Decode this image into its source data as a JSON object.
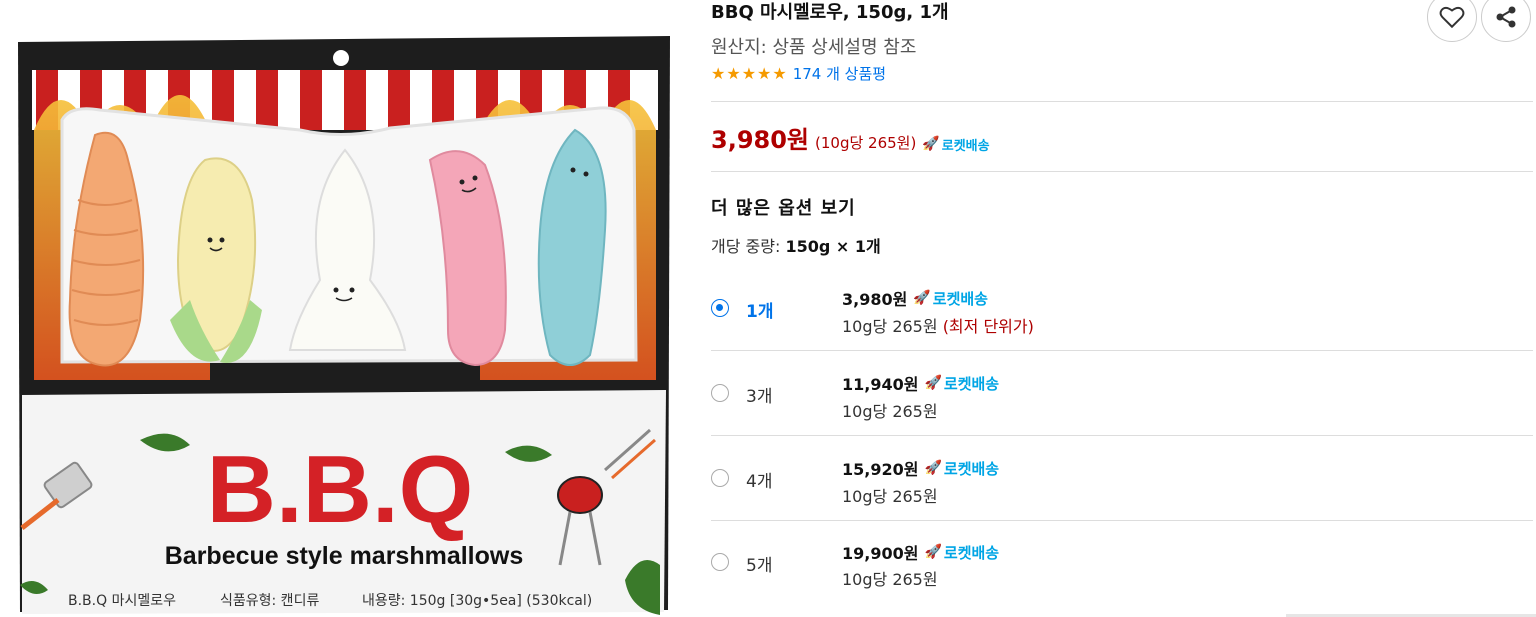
{
  "product": {
    "title": "BBQ 마시멜로우, 150g, 1개",
    "origin": "원산지: 상품 상세설명 참조",
    "review_count": "174 개 상품평",
    "rating_stars": 5,
    "price": "3,980원",
    "unit_price": "(10g당 265원)",
    "rocket_label": "로켓배송"
  },
  "options": {
    "heading": "더 많은 옵션 보기",
    "weight_label": "개당 중량:",
    "weight_value": "150g × 1개",
    "items": [
      {
        "qty": "1개",
        "price": "3,980원",
        "rocket": "로켓배송",
        "unit": "10g당 265원",
        "note": "(최저 단위가)",
        "selected": true
      },
      {
        "qty": "3개",
        "price": "11,940원",
        "rocket": "로켓배송",
        "unit": "10g당 265원",
        "note": "",
        "selected": false
      },
      {
        "qty": "4개",
        "price": "15,920원",
        "rocket": "로켓배송",
        "unit": "10g당 265원",
        "note": "",
        "selected": false
      },
      {
        "qty": "5개",
        "price": "19,900원",
        "rocket": "로켓배송",
        "unit": "10g당 265원",
        "note": "",
        "selected": false
      }
    ]
  },
  "package": {
    "brand": "B.B.Q",
    "subtitle": "Barbecue style marshmallows",
    "info_name": "B.B.Q 마시멜로우",
    "info_type": "식품유형: 캔디류",
    "info_content": "내용량: 150g [30g•5ea] (530kcal)"
  },
  "colors": {
    "price_red": "#ae0000",
    "link_blue": "#0073e9",
    "rocket_blue": "#00a5e5",
    "star_orange": "#f59a00"
  },
  "icons": [
    "heart-icon",
    "share-icon",
    "rocket-icon",
    "star-icon"
  ]
}
